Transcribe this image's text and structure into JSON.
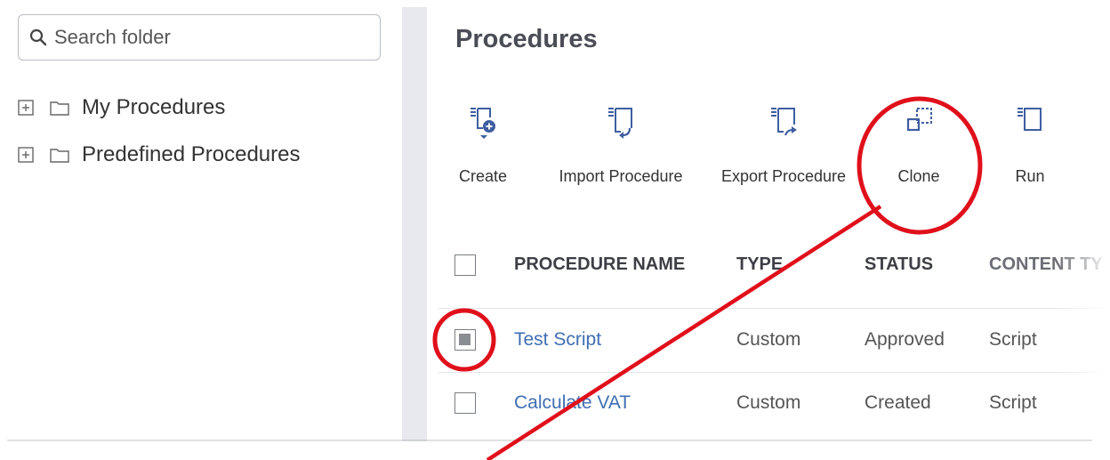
{
  "sidebar": {
    "search": {
      "placeholder": "Search folder",
      "value": ""
    },
    "tree": [
      {
        "label": "My Procedures",
        "icon": "folder-icon",
        "expander": "plus-box-icon"
      },
      {
        "label": "Predefined Procedures",
        "icon": "folder-icon",
        "expander": "plus-box-icon"
      }
    ]
  },
  "main": {
    "title": "Procedures",
    "toolbar": [
      {
        "label": "Create",
        "icon": "create-procedure-icon"
      },
      {
        "label": "Import Procedure",
        "icon": "import-procedure-icon"
      },
      {
        "label": "Export Procedure",
        "icon": "export-procedure-icon"
      },
      {
        "label": "Clone",
        "icon": "clone-icon"
      },
      {
        "label": "Run",
        "icon": "run-procedure-icon"
      }
    ],
    "table": {
      "headers": [
        "PROCEDURE NAME",
        "TYPE",
        "STATUS",
        "CONTENT TY"
      ],
      "rows": [
        {
          "name": "Test Script",
          "type": "Custom",
          "status": "Approved",
          "content_type": "Script",
          "checked": true
        },
        {
          "name": "Calculate VAT",
          "type": "Custom",
          "status": "Created",
          "content_type": "Script",
          "checked": false
        }
      ]
    }
  },
  "colors": {
    "link": "#3f6eb3",
    "icon": "#3f5ea0",
    "annotation": "#e0101b",
    "title": "#4a4d55"
  }
}
